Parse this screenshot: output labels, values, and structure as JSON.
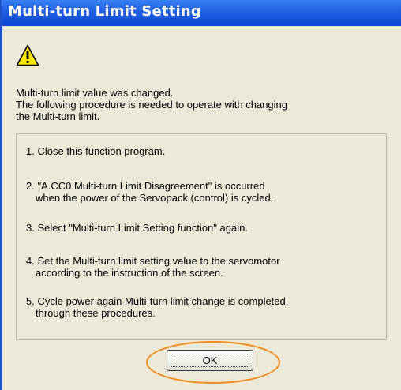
{
  "window": {
    "title": "Multi-turn Limit Setting"
  },
  "icon": "warning-icon",
  "message": {
    "lines": [
      "Multi-turn limit value was changed.",
      "The following procedure is needed to operate with changing",
      "the Multi-turn limit."
    ]
  },
  "steps": [
    {
      "line1": "1. Close this function program.",
      "line2": ""
    },
    {
      "line1": "2. \"A.CC0.Multi-turn Limit Disagreement\" is occurred",
      "line2": "when the power of the Servopack (control) is cycled."
    },
    {
      "line1": "3. Select  \"Multi-turn Limit Setting function\" again.",
      "line2": ""
    },
    {
      "line1": "4. Set the Multi-turn limit setting value to the servomotor",
      "line2": "according to the instruction of the screen."
    },
    {
      "line1": "5. Cycle power again Multi-turn limit change is completed,",
      "line2": "through these procedures."
    }
  ],
  "buttons": {
    "ok_label": "OK"
  },
  "colors": {
    "title_bar": "#1f5fe0",
    "dialog_background": "#ece9d8",
    "highlight": "#f08a1c",
    "warning_fill": "#ffe600"
  }
}
